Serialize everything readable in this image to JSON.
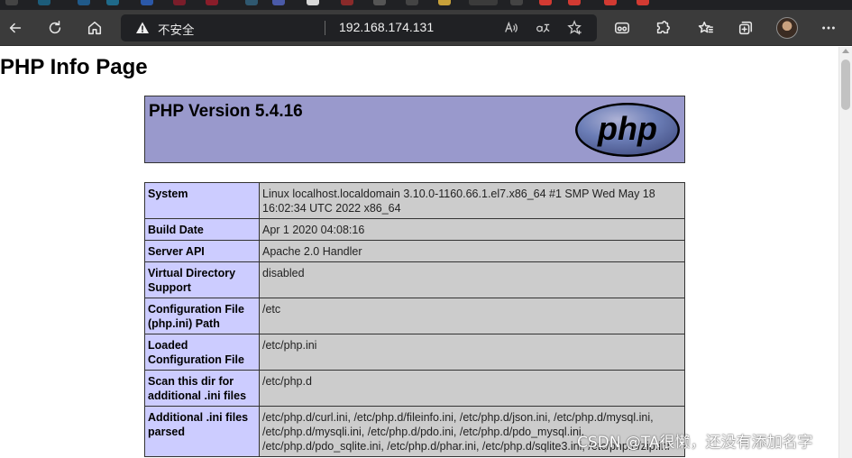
{
  "browser": {
    "security_label": "不安全",
    "address": "192.168.174.131",
    "read_aloud_label": "Aͅ",
    "translate_label": "á"
  },
  "page": {
    "heading": "PHP Info Page",
    "php_version": "PHP Version 5.4.16",
    "logo_text": "php",
    "rows": [
      {
        "key": "System",
        "value": "Linux localhost.localdomain 3.10.0-1160.66.1.el7.x86_64 #1 SMP Wed May 18 16:02:34 UTC 2022 x86_64"
      },
      {
        "key": "Build Date",
        "value": "Apr 1 2020 04:08:16"
      },
      {
        "key": "Server API",
        "value": "Apache 2.0 Handler"
      },
      {
        "key": "Virtual Directory Support",
        "value": "disabled"
      },
      {
        "key": "Configuration File (php.ini) Path",
        "value": "/etc"
      },
      {
        "key": "Loaded Configuration File",
        "value": "/etc/php.ini"
      },
      {
        "key": "Scan this dir for additional .ini files",
        "value": "/etc/php.d"
      },
      {
        "key": "Additional .ini files parsed",
        "value": "/etc/php.d/curl.ini, /etc/php.d/fileinfo.ini, /etc/php.d/json.ini, /etc/php.d/mysql.ini, /etc/php.d/mysqli.ini, /etc/php.d/pdo.ini, /etc/php.d/pdo_mysql.ini, /etc/php.d/pdo_sqlite.ini, /etc/php.d/phar.ini, /etc/php.d/sqlite3.ini, /etc/php.d/zip.ini"
      }
    ]
  },
  "watermark": "CSDN @TA很懒，还没有添加名字",
  "icons": {
    "back": "back-arrow-icon",
    "refresh": "refresh-icon",
    "home": "home-icon",
    "warning": "warning-icon",
    "favorite": "add-favorite-icon",
    "extensions": "extensions-icon",
    "collections": "collections-icon",
    "more": "more-icon"
  },
  "colors": {
    "php_header": "#9999cc",
    "key_cell": "#ccccff",
    "value_cell": "#cccccc",
    "toolbar": "#3b3b3b",
    "address_bar": "#202124"
  }
}
